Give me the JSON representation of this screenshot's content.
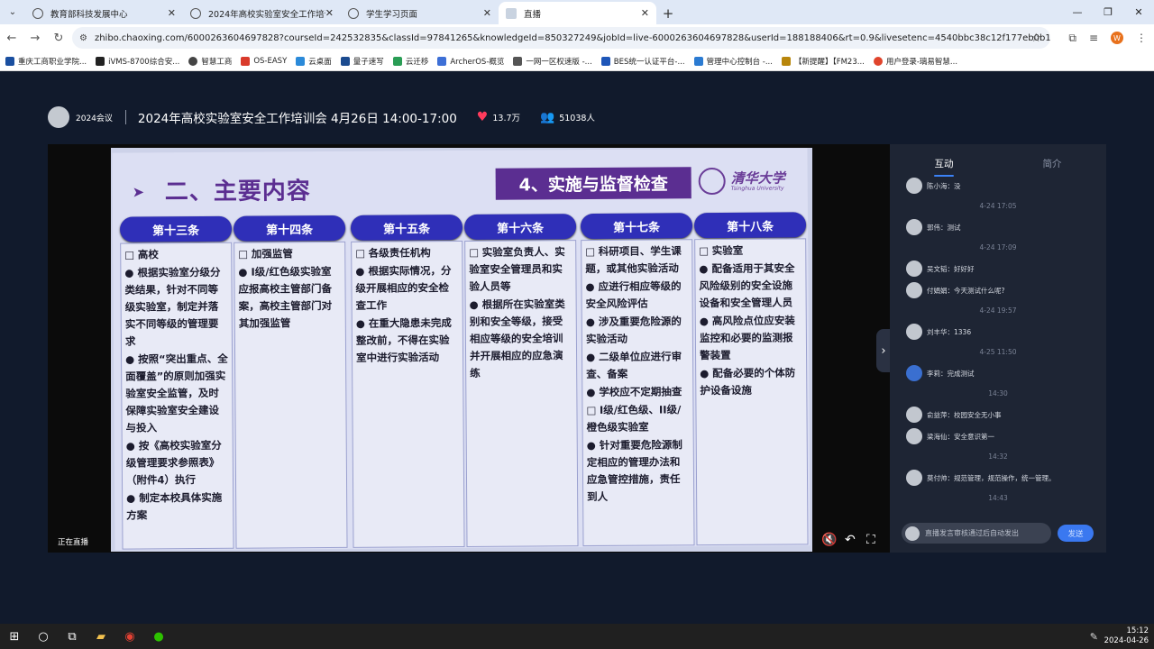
{
  "browser": {
    "tabs": [
      {
        "title": "教育部科技发展中心",
        "active": false
      },
      {
        "title": "2024年高校实验室安全工作培训会",
        "active": false
      },
      {
        "title": "学生学习页面",
        "active": false
      },
      {
        "title": "直播",
        "active": true
      }
    ],
    "url": "zhibo.chaoxing.com/6000263604697828?courseId=242532835&classId=97841265&knowledgeId=850327249&jobId=live-6000263604697828&userId=188188406&rt=0.9&livesetenc=4540bbc38c12f177eb0b14b08008722e&isjob...",
    "profile_initial": "W",
    "bookmarks": [
      "重庆工商职业学院...",
      "iVMS-8700综合安...",
      "智慧工商",
      "OS-EASY",
      "云桌面",
      "量子速写",
      "云迁移",
      "ArcherOS-概览",
      "一网一区权速版 -...",
      "BES统一认证平台-...",
      "管理中心控制台 -...",
      "【新提醒】【FM23...",
      "用户登录-璃易智慧..."
    ]
  },
  "live": {
    "channel": "2024会议",
    "title": "2024年高校实验室安全工作培训会 4月26日 14:00-17:00",
    "likes": "13.7万",
    "viewers": "51038人",
    "status": "正在直播"
  },
  "slide": {
    "section_title": "二、主要内容",
    "box_title": "4、实施与监督检查",
    "logo_name": "清华大学",
    "logo_sub": "Tsinghua University",
    "columns": [
      {
        "header": "第十三条",
        "lines": [
          {
            "t": "sq",
            "x": "高校"
          },
          {
            "t": "bl",
            "x": "根据实验室分级分类结果，针对不同等级实验室，制定并落实不同等级的管理要求"
          },
          {
            "t": "bl",
            "x": "按照“突出重点、全面覆盖”的原则加强实验室安全监管，及时保障实验室安全建设与投入"
          },
          {
            "t": "bl",
            "x": "按《高校实验室分级管理要求参照表》（附件4）执行"
          },
          {
            "t": "bl",
            "x": "制定本校具体实施方案"
          }
        ]
      },
      {
        "header": "第十四条",
        "lines": [
          {
            "t": "sq",
            "x": "加强监管"
          },
          {
            "t": "bl",
            "x": "I级/红色级实验室应报高校主管部门备案，高校主管部门对其加强监管"
          }
        ]
      },
      {
        "header": "第十五条",
        "lines": [
          {
            "t": "sq",
            "x": "各级责任机构"
          },
          {
            "t": "bl",
            "x": "根据实际情况，分级开展相应的安全检查工作"
          },
          {
            "t": "bl",
            "x": "在重大隐患未完成整改前，不得在实验室中进行实验活动"
          }
        ]
      },
      {
        "header": "第十六条",
        "lines": [
          {
            "t": "sq",
            "x": "实验室负责人、实验室安全管理员和实验人员等"
          },
          {
            "t": "bl",
            "x": "根据所在实验室类别和安全等级，接受相应等级的安全培训并开展相应的应急演练"
          }
        ]
      },
      {
        "header": "第十七条",
        "lines": [
          {
            "t": "sq",
            "x": "科研项目、学生课题，或其他实验活动"
          },
          {
            "t": "bl",
            "x": "应进行相应等级的安全风险评估"
          },
          {
            "t": "bl",
            "x": "涉及重要危险源的实验活动"
          },
          {
            "t": "bl",
            "x": "二级单位应进行审查、备案"
          },
          {
            "t": "bl",
            "x": "学校应不定期抽查"
          },
          {
            "t": "sq",
            "x": "I级/红色级、II级/橙色级实验室"
          },
          {
            "t": "bl",
            "x": "针对重要危险源制定相应的管理办法和应急管控措施，责任到人"
          }
        ]
      },
      {
        "header": "第十八条",
        "lines": [
          {
            "t": "sq",
            "x": "实验室"
          },
          {
            "t": "bl",
            "x": "配备适用于其安全风险级别的安全设施设备和安全管理人员"
          },
          {
            "t": "bl",
            "x": "高风险点位应安装监控和必要的监测报警装置"
          },
          {
            "t": "bl",
            "x": "配备必要的个体防护设备设施"
          }
        ]
      }
    ]
  },
  "panel": {
    "tabs": [
      "互动",
      "简介"
    ],
    "messages": [
      {
        "type": "msg",
        "text": "陈小海：没"
      },
      {
        "type": "time",
        "text": "4-24 17:05"
      },
      {
        "type": "msg",
        "text": "郭伟：测试"
      },
      {
        "type": "time",
        "text": "4-24 17:09"
      },
      {
        "type": "msg",
        "text": "吴文韬：好好好"
      },
      {
        "type": "msg",
        "text": "付娟娟：今天测试什么呢?"
      },
      {
        "type": "time",
        "text": "4-24 19:57"
      },
      {
        "type": "msg",
        "text": "刘丰华：1336"
      },
      {
        "type": "time",
        "text": "4-25 11:50"
      },
      {
        "type": "msg",
        "text": "李莉：完成测试",
        "blue": true
      },
      {
        "type": "time",
        "text": "14:30"
      },
      {
        "type": "msg",
        "text": "俞益萍：校园安全无小事"
      },
      {
        "type": "msg",
        "text": "梁海仙：安全意识第一"
      },
      {
        "type": "time",
        "text": "14:32"
      },
      {
        "type": "msg",
        "text": "莫付帅：规范管理，规范操作，统一管理。"
      },
      {
        "type": "time",
        "text": "14:43"
      }
    ],
    "input_placeholder": "直播发言审核通过后自动发出",
    "send_label": "发送"
  },
  "taskbar": {
    "time": "15:12",
    "date": "2024-04-26"
  }
}
